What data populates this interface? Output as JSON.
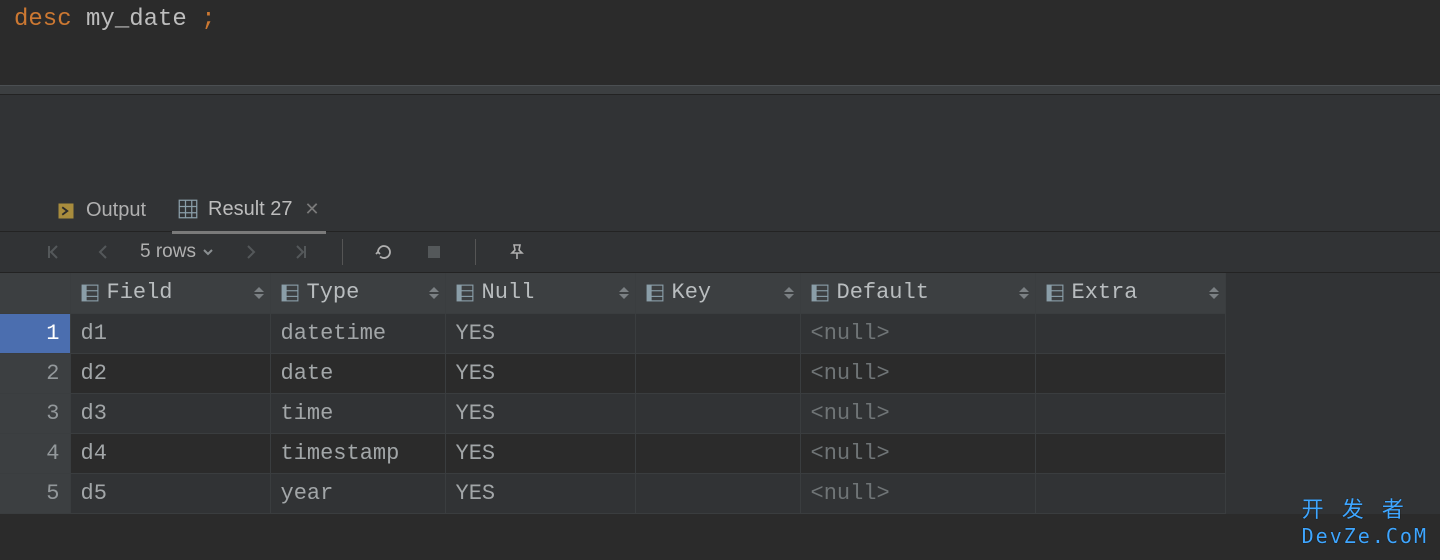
{
  "editor": {
    "keyword": "desc",
    "identifier": "my_date",
    "semicolon": ";"
  },
  "tabs": {
    "output": "Output",
    "result": "Result 27"
  },
  "toolbar": {
    "rowcount": "5 rows"
  },
  "columns": [
    "Field",
    "Type",
    "Null",
    "Key",
    "Default",
    "Extra"
  ],
  "rows": [
    {
      "n": "1",
      "Field": "d1",
      "Type": "datetime",
      "Null": "YES",
      "Key": "",
      "Default": "<null>",
      "Extra": ""
    },
    {
      "n": "2",
      "Field": "d2",
      "Type": "date",
      "Null": "YES",
      "Key": "",
      "Default": "<null>",
      "Extra": ""
    },
    {
      "n": "3",
      "Field": "d3",
      "Type": "time",
      "Null": "YES",
      "Key": "",
      "Default": "<null>",
      "Extra": ""
    },
    {
      "n": "4",
      "Field": "d4",
      "Type": "timestamp",
      "Null": "YES",
      "Key": "",
      "Default": "<null>",
      "Extra": ""
    },
    {
      "n": "5",
      "Field": "d5",
      "Type": "year",
      "Null": "YES",
      "Key": "",
      "Default": "<null>",
      "Extra": ""
    }
  ],
  "watermark": {
    "line1": "开 发 者",
    "line2": "DevZe.CoM"
  }
}
